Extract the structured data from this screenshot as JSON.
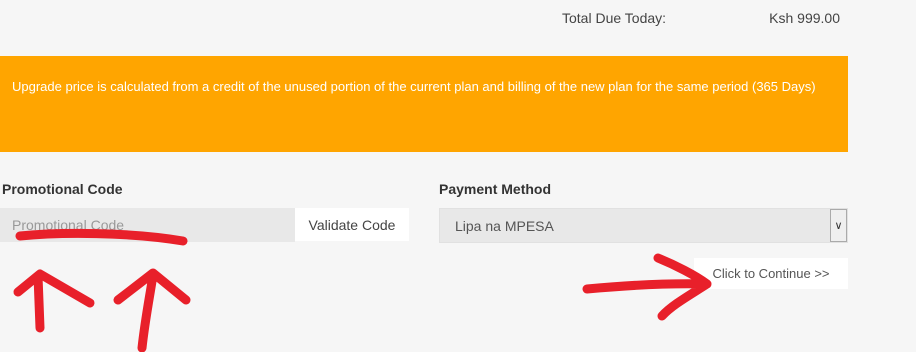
{
  "summary": {
    "total_label": "Total Due Today:",
    "total_value": "Ksh 999.00"
  },
  "notice": {
    "text": "Upgrade price is calculated from a credit of the unused portion of the current plan and billing of the new plan for the same period (365 Days)",
    "background_color": "#ffa500"
  },
  "promo": {
    "label": "Promotional Code",
    "placeholder": "Promotional Code",
    "value": "",
    "validate_label": "Validate Code"
  },
  "payment": {
    "label": "Payment Method",
    "selected": "Lipa na MPESA",
    "arrow_icon": "chevron-down-icon"
  },
  "actions": {
    "continue_label": "Click to Continue >>"
  },
  "annotations": {
    "color": "#e8202a"
  }
}
